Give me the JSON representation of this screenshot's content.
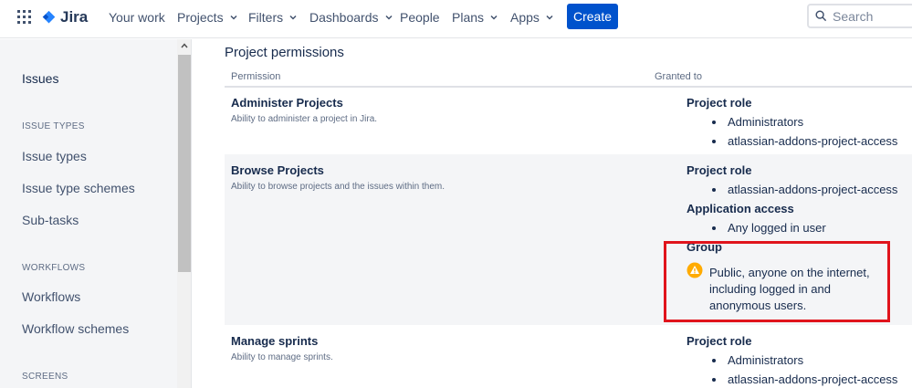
{
  "nav": {
    "logo": "Jira",
    "items": [
      {
        "label": "Your work"
      },
      {
        "label": "Projects"
      },
      {
        "label": "Filters"
      },
      {
        "label": "Dashboards"
      },
      {
        "label": "People"
      },
      {
        "label": "Plans"
      },
      {
        "label": "Apps"
      }
    ],
    "create_label": "Create",
    "search_placeholder": "Search"
  },
  "sidebar": {
    "items": [
      {
        "label": "Issues"
      },
      {
        "label": "ISSUE TYPES"
      },
      {
        "label": "Issue types"
      },
      {
        "label": "Issue type schemes"
      },
      {
        "label": "Sub-tasks"
      },
      {
        "label": "WORKFLOWS"
      },
      {
        "label": "Workflows"
      },
      {
        "label": "Workflow schemes"
      },
      {
        "label": "SCREENS"
      }
    ]
  },
  "main": {
    "section_title": "Project permissions",
    "columns": {
      "permission": "Permission",
      "granted_to": "Granted to"
    },
    "permissions": [
      {
        "name": "Administer Projects",
        "description": "Ability to administer a project in Jira.",
        "grants": [
          {
            "heading": "Project role",
            "items": [
              "Administrators",
              "atlassian-addons-project-access"
            ]
          }
        ]
      },
      {
        "name": "Browse Projects",
        "description": "Ability to browse projects and the issues within them.",
        "grants": [
          {
            "heading": "Project role",
            "items": [
              "atlassian-addons-project-access"
            ]
          },
          {
            "heading": "Application access",
            "items": [
              "Any logged in user"
            ]
          },
          {
            "heading": "Group",
            "warning_lines": [
              "Public, anyone on the internet,",
              "including logged in and",
              "anonymous users."
            ]
          }
        ]
      },
      {
        "name": "Manage sprints",
        "description": "Ability to manage sprints.",
        "grants": [
          {
            "heading": "Project role",
            "items": [
              "Administrators",
              "atlassian-addons-project-access"
            ]
          }
        ]
      }
    ]
  },
  "colors": {
    "brand": "#0052cc",
    "highlight": "#e0141c",
    "warning": "#ffab00"
  }
}
